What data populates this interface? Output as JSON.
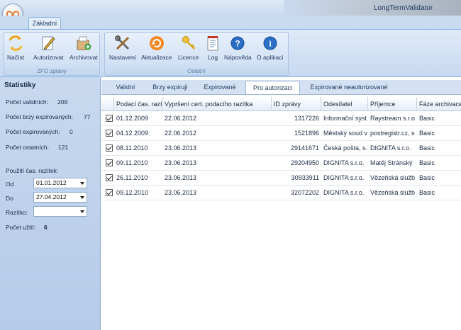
{
  "window": {
    "title": "LongTermValidator"
  },
  "ribbon": {
    "tab": "Základní",
    "groups": [
      {
        "label": "ZFO zprávy",
        "buttons": [
          "Načíst",
          "Autorizovat",
          "Archivovat"
        ]
      },
      {
        "label": "Ostatní",
        "buttons": [
          "Nastavení",
          "Aktualizace",
          "Licence",
          "Log",
          "Nápověda",
          "O aplikaci"
        ]
      }
    ]
  },
  "sidebar": {
    "title": "Statistiky",
    "stats": [
      {
        "label": "Počet validních:",
        "value": "209"
      },
      {
        "label": "Počet brzy expirovaných:",
        "value": "77"
      },
      {
        "label": "Počet expirovaných:",
        "value": "0"
      },
      {
        "label": "Počet ostatních:",
        "value": "121"
      }
    ],
    "stamp_usage_label": "Použití čas. razítek:",
    "from_label": "Od",
    "from_value": "01.01.2012",
    "to_label": "Do",
    "to_value": "27.04.2012",
    "stamp_label": "Razítko:",
    "stamp_value": "",
    "uses_label": "Počet užití:",
    "uses_value": "6"
  },
  "tabs": [
    "Validní",
    "Brzy expirují",
    "Expirované",
    "Pro autorizaci",
    "Expirované neautorizované"
  ],
  "active_tab": "Pro autorizaci",
  "table": {
    "columns": [
      "Podací čas. razí",
      "Vypršení cert. podacího razítka",
      "ID zprávy",
      "Odesílatel",
      "Příjemce",
      "Fáze archivace"
    ],
    "rows": [
      {
        "checked": true,
        "podaci": "01.12.2009",
        "vyprseni": "22.06.2012",
        "id": "1317226",
        "odesilatel": "Informační syst",
        "prijemce": "Raystream s.r.o",
        "faze": "Basic"
      },
      {
        "checked": true,
        "podaci": "04.12.2009",
        "vyprseni": "22.06.2012",
        "id": "1521896",
        "odesilatel": "Městský soud v",
        "prijemce": "postregistr.cz, s",
        "faze": "Basic"
      },
      {
        "checked": true,
        "podaci": "08.11.2010",
        "vyprseni": "23.06.2013",
        "id": "29141671",
        "odesilatel": "Česká pošta, s.",
        "prijemce": "DIGNITA s.r.o.",
        "faze": "Basic"
      },
      {
        "checked": true,
        "podaci": "09.11.2010",
        "vyprseni": "23.06.2013",
        "id": "29204950",
        "odesilatel": "DIGNITA s.r.o.",
        "prijemce": "Matěj Stránský",
        "faze": "Basic"
      },
      {
        "checked": true,
        "podaci": "26.11.2010",
        "vyprseni": "23.06.2013",
        "id": "30933911",
        "odesilatel": "DIGNITA s.r.o.",
        "prijemce": "Vězeňská služb",
        "faze": "Basic"
      },
      {
        "checked": true,
        "podaci": "09.12.2010",
        "vyprseni": "23.06.2013",
        "id": "32072202",
        "odesilatel": "DIGNITA s.r.o.",
        "prijemce": "Vězeňská služb",
        "faze": "Basic"
      }
    ]
  },
  "icons": {
    "orb": "infinity-logo-icon",
    "load": "folder-arrows-icon",
    "authorize": "pen-paper-icon",
    "archive": "archive-box-icon",
    "settings": "tools-icon",
    "update": "refresh-icon",
    "license": "key-icon",
    "log": "notepad-icon",
    "help": "help-icon",
    "about": "info-icon"
  },
  "colors": {
    "accent": "#3a78c9",
    "sidebar": "#bed1eb",
    "ribbon": "#d3e2f5"
  }
}
